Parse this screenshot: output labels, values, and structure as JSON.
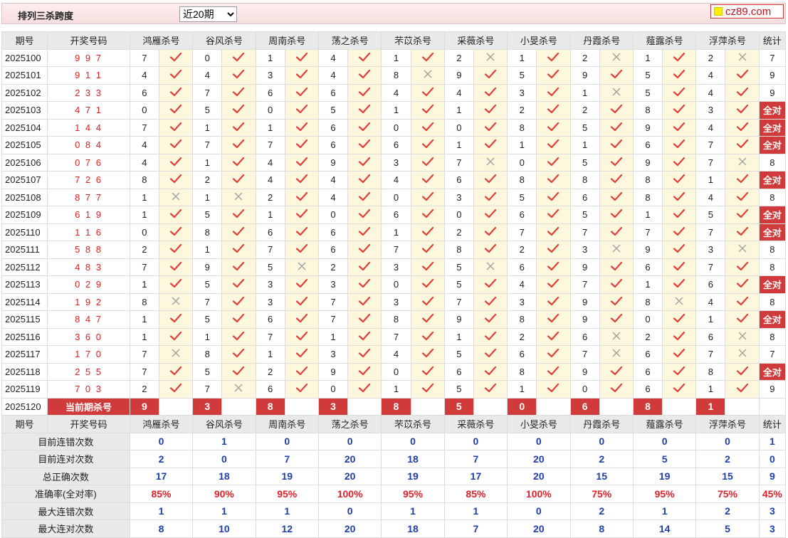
{
  "header": {
    "title": "排列三杀跨度",
    "period_select": "近20期",
    "logo": "cz89.com"
  },
  "columns": {
    "period": "期号",
    "draw": "开奖号码",
    "experts": [
      "鸿雁杀号",
      "谷风杀号",
      "周南杀号",
      "荡之杀号",
      "芣苡杀号",
      "采薇杀号",
      "小旻杀号",
      "丹霞杀号",
      "薤露杀号",
      "浮萍杀号"
    ],
    "stat": "统计"
  },
  "rows": [
    {
      "period": "2025100",
      "draw": "9 9 7",
      "kills": [
        7,
        0,
        1,
        4,
        1,
        2,
        1,
        2,
        1,
        2
      ],
      "results": [
        1,
        1,
        1,
        1,
        1,
        0,
        1,
        0,
        1,
        0
      ],
      "stat": "7"
    },
    {
      "period": "2025101",
      "draw": "9 1 1",
      "kills": [
        4,
        4,
        3,
        4,
        8,
        9,
        5,
        9,
        5,
        4
      ],
      "results": [
        1,
        1,
        1,
        1,
        0,
        1,
        1,
        1,
        1,
        1
      ],
      "stat": "9"
    },
    {
      "period": "2025102",
      "draw": "2 3 3",
      "kills": [
        6,
        7,
        6,
        6,
        4,
        4,
        3,
        1,
        5,
        4
      ],
      "results": [
        1,
        1,
        1,
        1,
        1,
        1,
        1,
        0,
        1,
        1
      ],
      "stat": "9"
    },
    {
      "period": "2025103",
      "draw": "4 7 1",
      "kills": [
        0,
        5,
        0,
        5,
        1,
        1,
        2,
        2,
        8,
        3
      ],
      "results": [
        1,
        1,
        1,
        1,
        1,
        1,
        1,
        1,
        1,
        1
      ],
      "stat": "全对"
    },
    {
      "period": "2025104",
      "draw": "1 4 4",
      "kills": [
        7,
        1,
        1,
        6,
        0,
        0,
        8,
        5,
        9,
        4
      ],
      "results": [
        1,
        1,
        1,
        1,
        1,
        1,
        1,
        1,
        1,
        1
      ],
      "stat": "全对"
    },
    {
      "period": "2025105",
      "draw": "0 8 4",
      "kills": [
        4,
        7,
        7,
        6,
        6,
        1,
        1,
        1,
        6,
        7
      ],
      "results": [
        1,
        1,
        1,
        1,
        1,
        1,
        1,
        1,
        1,
        1
      ],
      "stat": "全对"
    },
    {
      "period": "2025106",
      "draw": "0 7 6",
      "kills": [
        4,
        1,
        4,
        9,
        3,
        7,
        0,
        5,
        9,
        7
      ],
      "results": [
        1,
        1,
        1,
        1,
        1,
        0,
        1,
        1,
        1,
        0
      ],
      "stat": "8"
    },
    {
      "period": "2025107",
      "draw": "7 2 6",
      "kills": [
        8,
        2,
        4,
        4,
        4,
        6,
        8,
        8,
        8,
        1
      ],
      "results": [
        1,
        1,
        1,
        1,
        1,
        1,
        1,
        1,
        1,
        1
      ],
      "stat": "全对"
    },
    {
      "period": "2025108",
      "draw": "8 7 7",
      "kills": [
        1,
        1,
        2,
        4,
        0,
        3,
        5,
        6,
        8,
        4
      ],
      "results": [
        0,
        0,
        1,
        1,
        1,
        1,
        1,
        1,
        1,
        1
      ],
      "stat": "8"
    },
    {
      "period": "2025109",
      "draw": "6 1 9",
      "kills": [
        1,
        5,
        1,
        0,
        6,
        0,
        6,
        5,
        1,
        5
      ],
      "results": [
        1,
        1,
        1,
        1,
        1,
        1,
        1,
        1,
        1,
        1
      ],
      "stat": "全对"
    },
    {
      "period": "2025110",
      "draw": "1 1 6",
      "kills": [
        0,
        8,
        6,
        6,
        1,
        2,
        7,
        7,
        7,
        7
      ],
      "results": [
        1,
        1,
        1,
        1,
        1,
        1,
        1,
        1,
        1,
        1
      ],
      "stat": "全对"
    },
    {
      "period": "2025111",
      "draw": "5 8 8",
      "kills": [
        2,
        1,
        7,
        6,
        7,
        8,
        2,
        3,
        9,
        3
      ],
      "results": [
        1,
        1,
        1,
        1,
        1,
        1,
        1,
        0,
        1,
        0
      ],
      "stat": "8"
    },
    {
      "period": "2025112",
      "draw": "4 8 3",
      "kills": [
        7,
        9,
        5,
        2,
        3,
        5,
        6,
        9,
        6,
        7
      ],
      "results": [
        1,
        1,
        0,
        1,
        1,
        0,
        1,
        1,
        1,
        1
      ],
      "stat": "8"
    },
    {
      "period": "2025113",
      "draw": "0 2 9",
      "kills": [
        1,
        5,
        3,
        3,
        0,
        5,
        4,
        7,
        1,
        6
      ],
      "results": [
        1,
        1,
        1,
        1,
        1,
        1,
        1,
        1,
        1,
        1
      ],
      "stat": "全对"
    },
    {
      "period": "2025114",
      "draw": "1 9 2",
      "kills": [
        8,
        7,
        3,
        7,
        3,
        7,
        3,
        9,
        8,
        4
      ],
      "results": [
        0,
        1,
        1,
        1,
        1,
        1,
        1,
        1,
        0,
        1
      ],
      "stat": "8"
    },
    {
      "period": "2025115",
      "draw": "8 4 7",
      "kills": [
        1,
        5,
        6,
        7,
        8,
        9,
        8,
        9,
        0,
        1
      ],
      "results": [
        1,
        1,
        1,
        1,
        1,
        1,
        1,
        1,
        1,
        1
      ],
      "stat": "全对"
    },
    {
      "period": "2025116",
      "draw": "3 6 0",
      "kills": [
        1,
        1,
        7,
        1,
        7,
        1,
        2,
        6,
        2,
        6
      ],
      "results": [
        1,
        1,
        1,
        1,
        1,
        1,
        1,
        0,
        1,
        0
      ],
      "stat": "8"
    },
    {
      "period": "2025117",
      "draw": "1 7 0",
      "kills": [
        7,
        8,
        1,
        3,
        4,
        5,
        6,
        7,
        6,
        7
      ],
      "results": [
        0,
        1,
        1,
        1,
        1,
        1,
        1,
        0,
        1,
        0
      ],
      "stat": "7"
    },
    {
      "period": "2025118",
      "draw": "2 5 5",
      "kills": [
        7,
        5,
        2,
        9,
        0,
        6,
        8,
        9,
        6,
        8
      ],
      "results": [
        1,
        1,
        1,
        1,
        1,
        1,
        1,
        1,
        1,
        1
      ],
      "stat": "全对"
    },
    {
      "period": "2025119",
      "draw": "7 0 3",
      "kills": [
        2,
        7,
        6,
        0,
        1,
        5,
        1,
        0,
        6,
        1
      ],
      "results": [
        1,
        0,
        1,
        1,
        1,
        1,
        1,
        1,
        1,
        1
      ],
      "stat": "9"
    }
  ],
  "current": {
    "period": "2025120",
    "label": "当前期杀号",
    "kills": [
      9,
      3,
      8,
      3,
      8,
      5,
      0,
      6,
      8,
      1
    ]
  },
  "summary": [
    {
      "label": "目前连错次数",
      "values": [
        "0",
        "1",
        "0",
        "0",
        "0",
        "0",
        "0",
        "0",
        "0",
        "0",
        "1"
      ]
    },
    {
      "label": "目前连对次数",
      "values": [
        "2",
        "0",
        "7",
        "20",
        "18",
        "7",
        "20",
        "2",
        "5",
        "2",
        "0"
      ]
    },
    {
      "label": "总正确次数",
      "values": [
        "17",
        "18",
        "19",
        "20",
        "19",
        "17",
        "20",
        "15",
        "19",
        "15",
        "9"
      ]
    },
    {
      "label": "准确率(全对率)",
      "values": [
        "85%",
        "90%",
        "95%",
        "100%",
        "95%",
        "85%",
        "100%",
        "75%",
        "95%",
        "75%",
        "45%"
      ],
      "is_rate": true
    },
    {
      "label": "最大连错次数",
      "values": [
        "1",
        "1",
        "1",
        "0",
        "1",
        "1",
        "0",
        "2",
        "1",
        "2",
        "3"
      ]
    },
    {
      "label": "最大连对次数",
      "values": [
        "8",
        "10",
        "12",
        "20",
        "18",
        "7",
        "20",
        "8",
        "14",
        "5",
        "3"
      ]
    }
  ],
  "icons": {
    "correct": "check-icon",
    "wrong": "cross-icon"
  },
  "colors": {
    "accent_red": "#d13a3a",
    "check_red": "#e0403a",
    "stat_blue": "#1f3fa8",
    "mark_bg": "#fdf8dd"
  }
}
